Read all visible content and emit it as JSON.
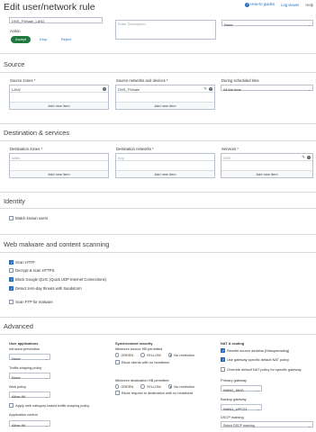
{
  "title": "Edit user/network rule",
  "toplinks": {
    "guides": "How-to guides",
    "log": "Log viewer",
    "help": "Help"
  },
  "rule": {
    "name_value": "DNS_FWsale_LAN2",
    "description_placeholder": "Enter Description",
    "position_value": "None",
    "action_label": "Action",
    "accept": "Accept",
    "drop": "Drop",
    "reject": "Reject"
  },
  "source": {
    "title": "Source",
    "zones_label": "Source zones *",
    "zones_value": "LAN2",
    "networks_label": "Source networks and devices *",
    "networks_value": "DNS_FWsale",
    "schedule_label": "During scheduled time",
    "schedule_value": "All the time",
    "add_new": "Add new item"
  },
  "destination": {
    "title": "Destination & services",
    "zones_label": "Destination zones *",
    "zones_value": "WAN",
    "networks_label": "Destination networks *",
    "networks_value": "Any",
    "services_label": "Services *",
    "services_value": "DNS",
    "add_new": "Add new item"
  },
  "identity": {
    "title": "Identity",
    "match_users": "Match known users"
  },
  "malware": {
    "title": "Web malware and content scanning",
    "scan_http": "Scan HTTP",
    "decrypt_https": "Decrypt & scan HTTPS",
    "block_quic": "Block Google QUIC (Quick UDP Internet Connections)",
    "detect_zero_day": "Detect zero-day threats with Sandstorm",
    "scan_ftp": "Scan FTP for malware"
  },
  "advanced": {
    "title": "Advanced",
    "user_apps": "User applications",
    "intrusion_label": "Intrusion prevention",
    "intrusion_value": "None",
    "traffic_label": "Traffic shaping policy",
    "traffic_value": "None",
    "web_label": "Web policy",
    "web_value": "Allow All",
    "apply_web": "Apply web category-based traffic shaping policy",
    "appctrl_label": "Application control",
    "appctrl_value": "Allow All",
    "sync_title": "Synchronized security",
    "min_source": "Minimum source HB permitted",
    "green": "GREEN",
    "yellow": "YELLOW",
    "no_restriction": "No restriction",
    "block_no_hb": "Block clients with no heartbeat",
    "min_dest": "Minimum destination HB permitted",
    "block_req": "Block request to destination with no heartbeat",
    "nat_title": "NAT & routing",
    "rewrite": "Rewrite source address (Masquerading)",
    "use_gw": "Use gateway specific default NAT policy",
    "override": "Override default NAT policy for specific gateway",
    "primary_label": "Primary gateway",
    "primary_value": "WAN2_IW41",
    "backup_label": "Backup gateway",
    "backup_value": "WAN1_UPC01",
    "dscp_label": "DSCP marking",
    "dscp_value": "Select DSCP marking"
  },
  "colors": {
    "accent": "#2a6ebb",
    "accept_green": "#1d7b3f"
  }
}
